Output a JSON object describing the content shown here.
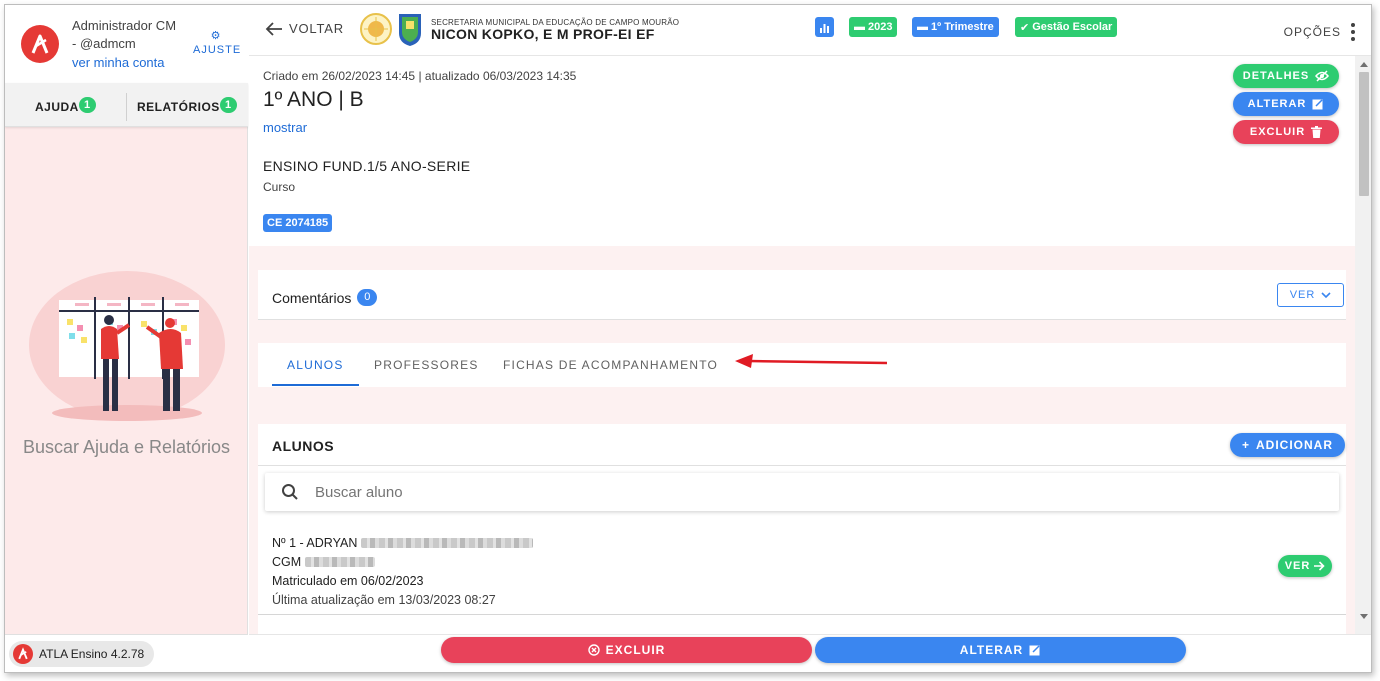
{
  "sidebar": {
    "user_name": "Administrador CM",
    "user_handle": "- @admcm",
    "account_link": "ver minha conta",
    "settings_label": "AJUSTE",
    "tabs": [
      {
        "label": "AJUDA",
        "badge": "1"
      },
      {
        "label": "RELATÓRIOS",
        "badge": "1"
      }
    ],
    "help_text": "Buscar Ajuda e Relatórios",
    "version": "ATLA Ensino 4.2.78"
  },
  "header": {
    "back_label": "VOLTAR",
    "school_sub": "SECRETARIA MUNICIPAL DA EDUCAÇÃO DE CAMPO MOURÃO",
    "school_name": "NICON KOPKO, E M PROF-EI EF",
    "chips": {
      "year": "2023",
      "term": "1º Trimestre",
      "module": "Gestão Escolar"
    },
    "options_label": "OPÇÕES"
  },
  "class_info": {
    "meta": "Criado em 26/02/2023 14:45 | atualizado 06/03/2023 14:35",
    "title": "1º ANO | B",
    "show_link": "mostrar",
    "course_name": "ENSINO FUND.1/5 ANO-SERIE",
    "course_label": "Curso",
    "code_chip": "CE 2074185",
    "actions": {
      "details": "DETALHES",
      "edit": "ALTERAR",
      "delete": "EXCLUIR"
    }
  },
  "comments": {
    "title": "Comentários",
    "count": "0",
    "view_label": "VER"
  },
  "tabs": [
    {
      "label": "ALUNOS",
      "active": true
    },
    {
      "label": "PROFESSORES",
      "active": false
    },
    {
      "label": "FICHAS DE ACOMPANHAMENTO",
      "active": false
    }
  ],
  "students": {
    "title": "ALUNOS",
    "add_label": "ADICIONAR",
    "search_placeholder": "Buscar aluno",
    "rows": [
      {
        "number_name": "Nº 1 - ADRYAN",
        "cgm_label": "CGM",
        "enrolled": "Matriculado em 06/02/2023",
        "updated": "Última atualização em 13/03/2023 08:27",
        "view_label": "VER"
      }
    ]
  },
  "bottom": {
    "delete_label": "EXCLUIR",
    "edit_label": "ALTERAR"
  },
  "colors": {
    "primary_blue": "#3a86f0",
    "success_green": "#2ecc71",
    "danger_red": "#e8425a",
    "brand_red": "#e53935",
    "link_blue": "#1e6bd6",
    "panel_pink": "#fdeaea"
  }
}
